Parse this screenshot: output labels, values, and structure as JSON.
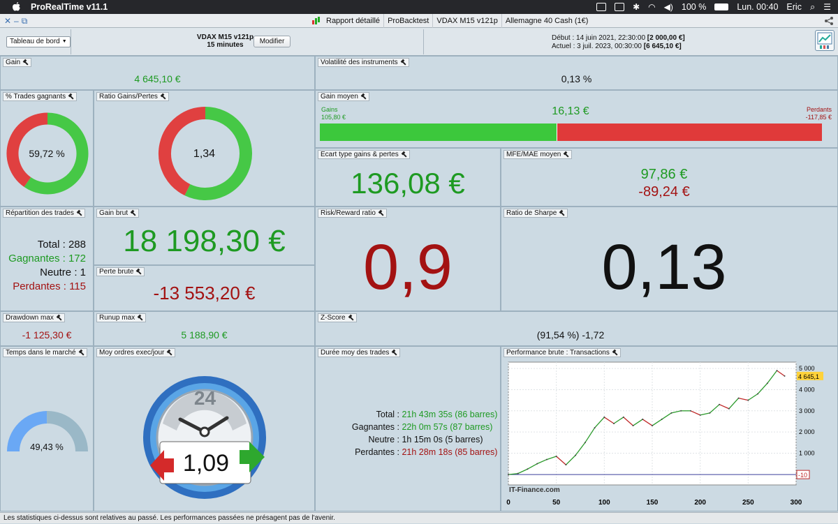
{
  "menubar": {
    "app_name": "ProRealTime v11.1",
    "battery": "100 %",
    "clock": "Lun. 00:40",
    "user": "Eric"
  },
  "toolbar": {
    "tabs": [
      "Rapport détaillé",
      "ProBacktest",
      "VDAX M15 v121p",
      "Allemagne 40 Cash (1€)"
    ]
  },
  "header": {
    "selector_label": "Tableau de bord",
    "system_name": "VDAX M15 v121p",
    "timeframe": "15 minutes",
    "modify_label": "Modifier",
    "start_label": "Début :",
    "start_date": "14 juin 2021, 22:30:00",
    "start_value": "[2 000,00 €]",
    "current_label": "Actuel :",
    "current_date": "3 juil. 2023, 00:30:00",
    "current_value": "[6 645,10 €]"
  },
  "panels": {
    "gain": {
      "title": "Gain",
      "value": "4 645,10 €"
    },
    "volatility": {
      "title": "Volatilité des instruments",
      "value": "0,13 %"
    },
    "pct_winning": {
      "title": "% Trades gagnants",
      "value": "59,72 %",
      "fraction": 0.5972
    },
    "ratio_gp": {
      "title": "Ratio Gains/Pertes",
      "value": "1,34",
      "fraction": 0.5727
    },
    "avg_gain": {
      "title": "Gain moyen",
      "value": "16,13 €",
      "gains_label": "Gains",
      "gains_value": "105,80 €",
      "losses_label": "Perdants",
      "losses_value": "-117,85 €",
      "fraction": 0.473
    },
    "std_dev": {
      "title": "Ecart type gains & pertes",
      "value": "136,08 €"
    },
    "mfe_mae": {
      "title": "MFE/MAE moyen",
      "mfe": "97,86 €",
      "mae": "-89,24 €"
    },
    "distribution": {
      "title": "Répartition des trades",
      "total_label": "Total :",
      "total": "288",
      "win_label": "Gagnantes :",
      "win": "172",
      "neutral_label": "Neutre :",
      "neutral": "1",
      "loss_label": "Perdantes :",
      "loss": "115"
    },
    "gross_gain": {
      "title": "Gain brut",
      "value": "18 198,30 €"
    },
    "gross_loss": {
      "title": "Perte brute",
      "value": "-13 553,20 €"
    },
    "risk_reward": {
      "title": "Risk/Reward ratio",
      "value": "0,9"
    },
    "sharpe": {
      "title": "Ratio de Sharpe",
      "value": "0,13"
    },
    "drawdown": {
      "title": "Drawdown max",
      "value": "-1 125,30 €"
    },
    "runup": {
      "title": "Runup max",
      "value": "5 188,90 €"
    },
    "zscore": {
      "title": "Z-Score",
      "value": "(91,54 %) -1,72"
    },
    "time_in_market": {
      "title": "Temps dans le marché",
      "value": "49,43 %",
      "fraction": 0.4943
    },
    "orders_per_day": {
      "title": "Moy ordres exec/jour",
      "value": "1,09",
      "clock_label": "24"
    },
    "avg_duration": {
      "title": "Durée moy des trades",
      "rows": [
        {
          "label": "Total :",
          "value": "21h 43m 35s (86 barres)",
          "color": "#1e9a22"
        },
        {
          "label": "Gagnantes :",
          "value": "22h 0m 57s (87 barres)",
          "color": "#1e9a22"
        },
        {
          "label": "Neutre :",
          "value": "1h 15m 0s (5 barres)",
          "color": "#111111"
        },
        {
          "label": "Perdantes :",
          "value": "21h 28m 18s (85 barres)",
          "color": "#a31212"
        }
      ]
    },
    "performance": {
      "title": "Performance brute : Transactions",
      "watermark": "IT-Finance.com",
      "last_label": "4 645,1",
      "zero_label": "-10"
    }
  },
  "chart_data": {
    "type": "line",
    "title": "Performance brute : Transactions",
    "x": [
      0,
      10,
      20,
      30,
      40,
      50,
      60,
      70,
      80,
      90,
      100,
      110,
      120,
      130,
      140,
      150,
      160,
      170,
      180,
      190,
      200,
      210,
      220,
      230,
      240,
      250,
      260,
      270,
      280,
      288
    ],
    "y": [
      -10,
      40,
      250,
      500,
      700,
      850,
      450,
      900,
      1500,
      2200,
      2700,
      2400,
      2700,
      2300,
      2600,
      2300,
      2600,
      2900,
      3000,
      3000,
      2800,
      2900,
      3300,
      3100,
      3600,
      3500,
      3800,
      4300,
      4900,
      4645.1
    ],
    "xticks": [
      0,
      50,
      100,
      150,
      200,
      250,
      300
    ],
    "yticks": [
      1000,
      2000,
      3000,
      4000,
      5000
    ],
    "xlim": [
      0,
      300
    ],
    "ylim": [
      -500,
      5300
    ],
    "grid": true
  },
  "statusbar": {
    "text": "Les statistiques ci-dessus sont relatives au passé. Les performances passées ne présagent pas de l'avenir."
  }
}
